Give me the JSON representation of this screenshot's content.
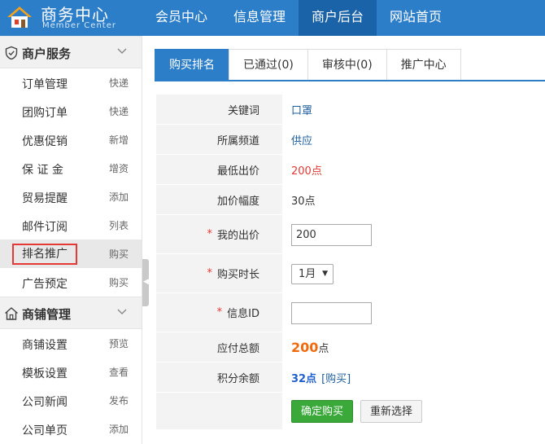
{
  "brand": {
    "title": "商务中心",
    "subtitle": "Member Center",
    "icon": "house-icon"
  },
  "topnav": [
    {
      "label": "会员中心",
      "active": false
    },
    {
      "label": "信息管理",
      "active": false
    },
    {
      "label": "商户后台",
      "active": true
    },
    {
      "label": "网站首页",
      "active": false
    }
  ],
  "sidebar": {
    "groups": [
      {
        "title": "商户服务",
        "icon": "shield-icon",
        "items": [
          {
            "label": "订单管理",
            "action": "快递"
          },
          {
            "label": "团购订单",
            "action": "快递"
          },
          {
            "label": "优惠促销",
            "action": "新增"
          },
          {
            "label": "保 证 金",
            "action": "增资"
          },
          {
            "label": "贸易提醒",
            "action": "添加"
          },
          {
            "label": "邮件订阅",
            "action": "列表"
          },
          {
            "label": "排名推广",
            "action": "购买",
            "current": true
          },
          {
            "label": "广告预定",
            "action": "购买"
          }
        ]
      },
      {
        "title": "商铺管理",
        "icon": "home-outline-icon",
        "items": [
          {
            "label": "商铺设置",
            "action": "预览"
          },
          {
            "label": "模板设置",
            "action": "查看"
          },
          {
            "label": "公司新闻",
            "action": "发布"
          },
          {
            "label": "公司单页",
            "action": "添加"
          }
        ]
      }
    ]
  },
  "tabs": [
    {
      "label": "购买排名",
      "active": true
    },
    {
      "label": "已通过(0)",
      "active": false
    },
    {
      "label": "审核中(0)",
      "active": false
    },
    {
      "label": "推广中心",
      "active": false
    }
  ],
  "form": {
    "keyword_label": "关键词",
    "keyword_value": "口罩",
    "channel_label": "所属频道",
    "channel_value": "供应",
    "min_bid_label": "最低出价",
    "min_bid_value": "200点",
    "increment_label": "加价幅度",
    "increment_value": "30点",
    "my_bid_label": "我的出价",
    "my_bid_value": "200",
    "duration_label": "购买时长",
    "duration_value": "1月",
    "info_id_label": "信息ID",
    "info_id_value": "",
    "total_label": "应付总额",
    "total_amount": "200",
    "total_unit": "点",
    "balance_label": "积分余额",
    "balance_value": "32点",
    "buy_link": "[购买]",
    "required_mark": "*",
    "confirm_button": "确定购买",
    "reset_button": "重新选择"
  },
  "colors": {
    "primary": "#2d7ec8",
    "nav_active": "#1b63a8",
    "green": "#3aa93a",
    "orange": "#f06a0c",
    "red": "#e53935"
  }
}
